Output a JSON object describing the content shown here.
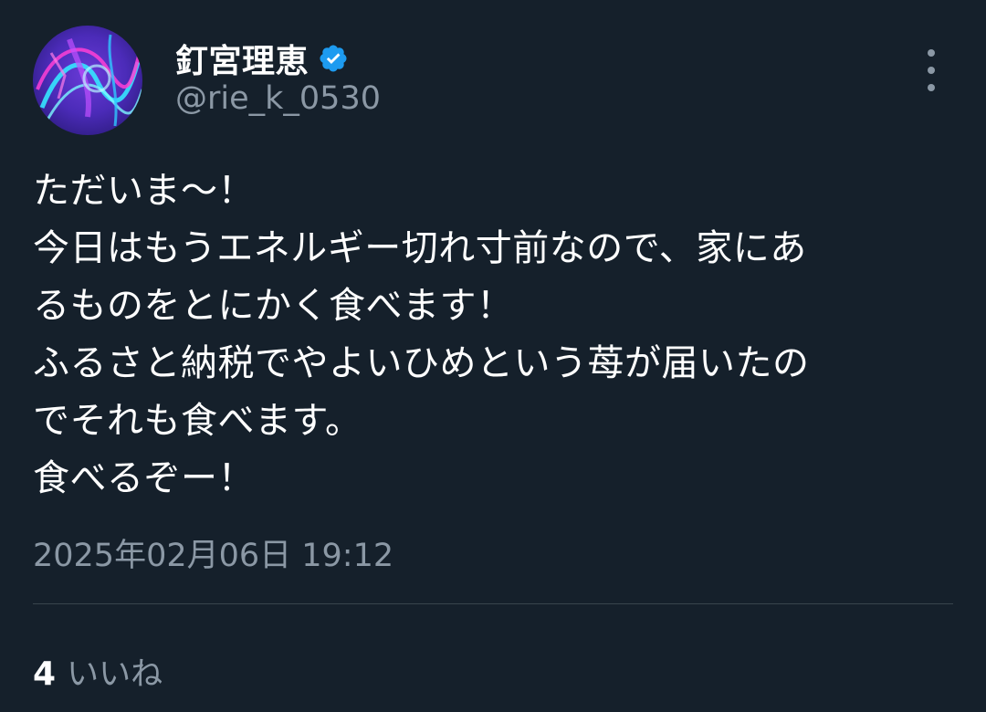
{
  "author": {
    "display_name": "釘宮理恵",
    "handle": "@rie_k_0530",
    "verified": true,
    "verified_icon": "verified-badge-icon"
  },
  "tweet": {
    "lines": [
      "ただいま〜！",
      "今日はもうエネルギー切れ寸前なので、家にあ",
      "るものをとにかく食べます！",
      "ふるさと納税でやよいひめという苺が届いたの",
      "でそれも食べます。",
      "食べるぞー！"
    ],
    "timestamp": "2025年02月06日 19:12"
  },
  "stats": {
    "likes_count": "4",
    "likes_label": "いいね"
  },
  "icons": {
    "more": "more-vertical-icon"
  },
  "colors": {
    "background": "#15202b",
    "text_primary": "#ffffff",
    "text_secondary": "#8b98a5",
    "verified": "#1d9bf0",
    "divider": "#38444d"
  }
}
